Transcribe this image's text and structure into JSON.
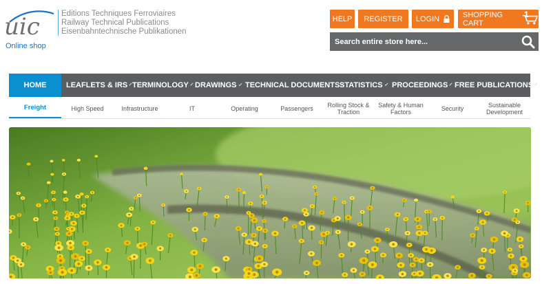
{
  "header": {
    "logo_text": "uic",
    "online_shop": "Online shop",
    "tagline": [
      "Editions Techniques Ferroviaires",
      "Railway Technical Publications",
      "Eisenbahntechnische Publikationen"
    ]
  },
  "top_buttons": {
    "help": "HELP",
    "register": "REGISTER",
    "login": "LOGIN",
    "cart": "SHOPPING CART",
    "cart_count": "1"
  },
  "search": {
    "placeholder": "Search entire store here..."
  },
  "main_nav": [
    {
      "label": "HOME"
    },
    {
      "label": "LEAFLETS & IRS"
    },
    {
      "label": "TERMINOLOGY"
    },
    {
      "label": "DRAWINGS"
    },
    {
      "label": "TECHNICAL DOCUMENTS"
    },
    {
      "label": "STATISTICS"
    },
    {
      "label": "PROCEEDINGS"
    },
    {
      "label": "FREE PUBLICATIONS"
    }
  ],
  "sub_nav": [
    {
      "label": "Freight"
    },
    {
      "label": "High Speed"
    },
    {
      "label": "Infrastructure"
    },
    {
      "label": "IT"
    },
    {
      "label": "Operating"
    },
    {
      "label": "Passengers"
    },
    {
      "label": "Rolling Stock & Traction"
    },
    {
      "label": "Safety & Human Factors"
    },
    {
      "label": "Security"
    },
    {
      "label": "Sustainable Development"
    }
  ],
  "colors": {
    "accent": "#f07820",
    "nav_bg": "#5c5d5e",
    "nav_active": "#0a8fd0",
    "link": "#1a73c8"
  }
}
